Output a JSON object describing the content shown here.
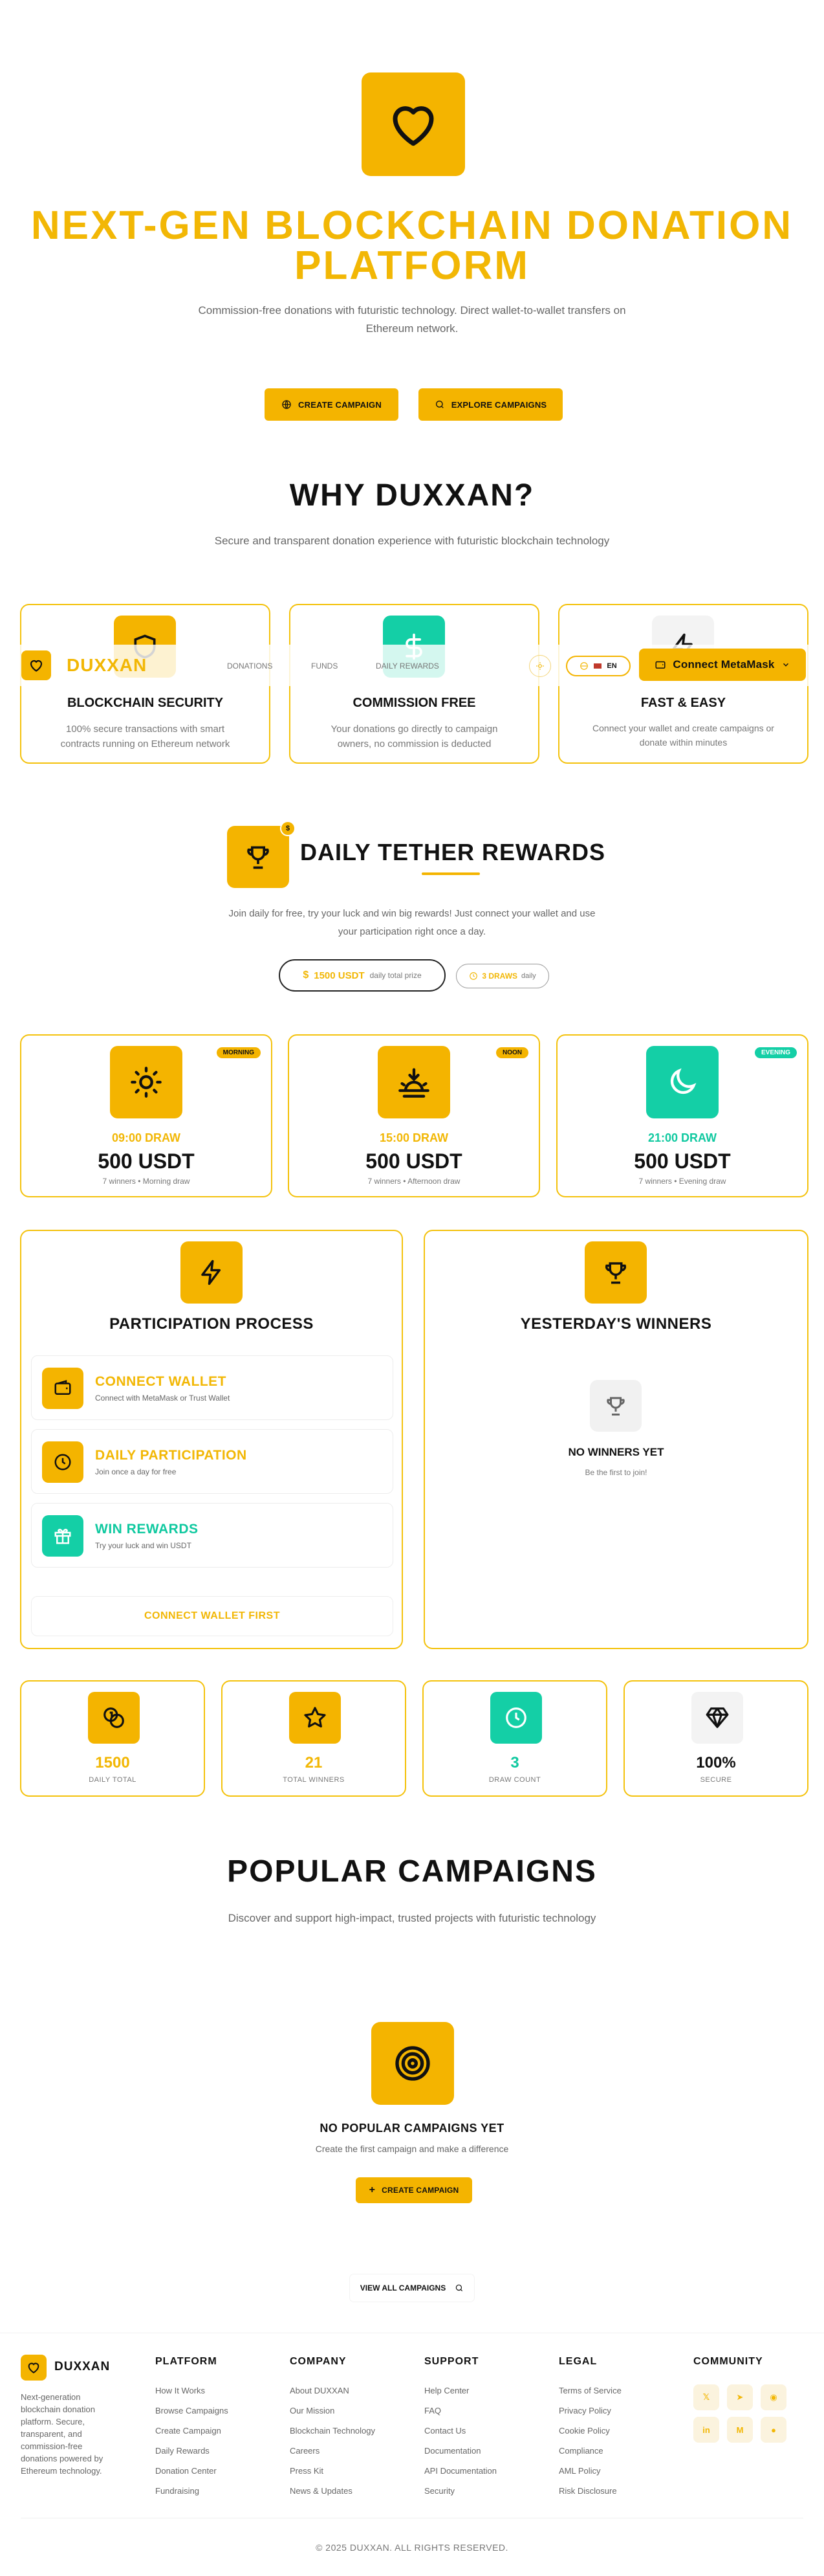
{
  "hero": {
    "title_line1": "NEXT-GEN BLOCKCHAIN DONATION",
    "title_line2": "PLATFORM",
    "subtitle_line1": "Commission-free donations with futuristic technology. Direct wallet-to-wallet transfers on",
    "subtitle_line2": "Ethereum network.",
    "create_btn": "CREATE CAMPAIGN",
    "explore_btn": "EXPLORE CAMPAIGNS"
  },
  "why": {
    "title": "WHY DUXXAN?",
    "subtitle": "Secure and transparent donation experience with futuristic blockchain technology",
    "cards": [
      {
        "title": "BLOCKCHAIN SECURITY",
        "desc1": "100% secure transactions with smart",
        "desc2": "contracts running on Ethereum network",
        "icon": "shield-icon"
      },
      {
        "title": "COMMISSION FREE",
        "desc1": "Your donations go directly to campaign",
        "desc2": "owners, no commission is deducted",
        "icon": "dollar-icon"
      },
      {
        "title": "FAST & EASY",
        "desc1": "Connect your wallet and create campaigns or",
        "desc2": "donate within minutes",
        "icon": "lightning-icon"
      }
    ]
  },
  "navbar": {
    "brand": "DUXXAN",
    "links": [
      "DONATIONS",
      "FUNDS",
      "DAILY REWARDS"
    ],
    "lang": "EN",
    "connect": "Connect MetaMask"
  },
  "rewards": {
    "title": "DAILY TETHER REWARDS",
    "subtitle_line1": "Join daily for free, try your luck and win big rewards! Just connect your wallet and use",
    "subtitle_line2": "your participation right once a day.",
    "prize_value": "1500 USDT",
    "prize_label": "daily total prize",
    "draws_value": "3 DRAWS",
    "draws_label": "daily",
    "draws": [
      {
        "badge": "MORNING",
        "time": "09:00 DRAW",
        "amount": "500 USDT",
        "note": "7 winners • Morning draw",
        "icon": "sun-icon"
      },
      {
        "badge": "NOON",
        "time": "15:00 DRAW",
        "amount": "500 USDT",
        "note": "7 winners • Afternoon draw",
        "icon": "sunset-icon"
      },
      {
        "badge": "EVENING",
        "time": "21:00 DRAW",
        "amount": "500 USDT",
        "note": "7 winners • Evening draw",
        "icon": "moon-icon"
      }
    ]
  },
  "process": {
    "title": "PARTICIPATION PROCESS",
    "steps": [
      {
        "title": "CONNECT WALLET",
        "desc": "Connect with MetaMask or Trust Wallet"
      },
      {
        "title": "DAILY PARTICIPATION",
        "desc": "Join once a day for free"
      },
      {
        "title": "WIN REWARDS",
        "desc": "Try your luck and win USDT"
      }
    ],
    "cta": "CONNECT WALLET FIRST"
  },
  "winners": {
    "title": "YESTERDAY'S WINNERS",
    "empty_title": "NO WINNERS YET",
    "empty_desc": "Be the first to join!"
  },
  "stats": [
    {
      "value": "1500",
      "label": "DAILY TOTAL"
    },
    {
      "value": "21",
      "label": "TOTAL WINNERS"
    },
    {
      "value": "3",
      "label": "DRAW COUNT"
    },
    {
      "value": "100%",
      "label": "SECURE"
    }
  ],
  "popular": {
    "title": "POPULAR CAMPAIGNS",
    "subtitle": "Discover and support high-impact, trusted projects with futuristic technology",
    "empty_title": "NO POPULAR CAMPAIGNS YET",
    "empty_desc": "Create the first campaign and make a difference",
    "create_btn": "CREATE CAMPAIGN",
    "view_all": "VIEW ALL CAMPAIGNS"
  },
  "footer": {
    "brand": "DUXXAN",
    "about": [
      "Next-generation",
      "blockchain donation",
      "platform. Secure,",
      "transparent, and",
      "commission-free",
      "donations powered by",
      "Ethereum technology."
    ],
    "platform": {
      "title": "PLATFORM",
      "links": [
        "How It Works",
        "Browse Campaigns",
        "Create Campaign",
        "Daily Rewards",
        "Donation Center",
        "Fundraising"
      ]
    },
    "company": {
      "title": "COMPANY",
      "links": [
        "About DUXXAN",
        "Our Mission",
        "Blockchain Technology",
        "Careers",
        "Press Kit",
        "News & Updates"
      ]
    },
    "support": {
      "title": "SUPPORT",
      "links": [
        "Help Center",
        "FAQ",
        "Contact Us",
        "Documentation",
        "API Documentation",
        "Security"
      ]
    },
    "legal": {
      "title": "LEGAL",
      "links": [
        "Terms of Service",
        "Privacy Policy",
        "Cookie Policy",
        "Compliance",
        "AML Policy",
        "Risk Disclosure"
      ]
    },
    "community": {
      "title": "COMMUNITY",
      "icons": [
        "twitter-icon",
        "telegram-icon",
        "discord-icon",
        "linkedin-icon",
        "medium-icon",
        "github-icon"
      ]
    },
    "copyright": "© 2025 DUXXAN. ALL RIGHTS RESERVED."
  },
  "colors": {
    "accent": "#f4b400",
    "teal": "#14cfa6",
    "text": "#111111"
  }
}
